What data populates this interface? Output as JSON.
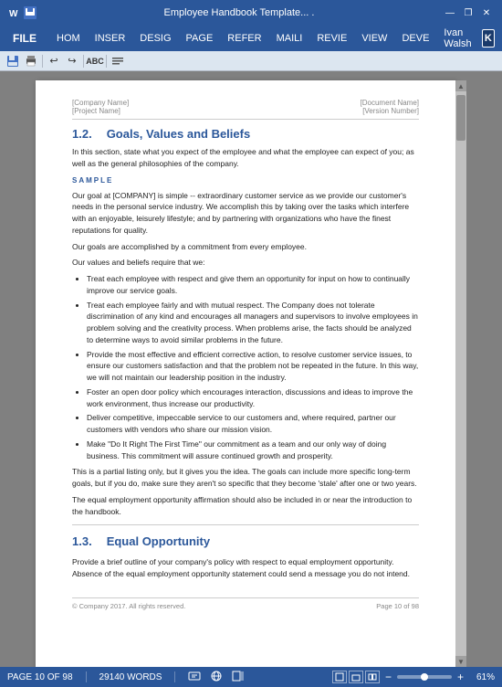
{
  "titlebar": {
    "title": "Employee Handbook Template... .",
    "question_icon": "?",
    "minimize_icon": "—",
    "restore_icon": "❐",
    "close_icon": "✕"
  },
  "ribbon": {
    "file_label": "FILE",
    "tabs": [
      "HOM",
      "INSER",
      "DESIG",
      "PAGE",
      "REFER",
      "MAILI",
      "REVIE",
      "VIEW",
      "DEVE"
    ],
    "user_name": "Ivan Walsh",
    "user_initial": "K"
  },
  "toolbar": {
    "buttons": [
      "💾",
      "🖨",
      "↩",
      "↪",
      "ABC",
      "≡"
    ]
  },
  "document": {
    "header_left": [
      "[Company Name]",
      "[Project Name]"
    ],
    "header_right": [
      "[Document Name]",
      "[Version Number]"
    ],
    "section_num": "1.2.",
    "section_title": "Goals, Values and Beliefs",
    "intro": "In this section, state what you expect of the employee and what the employee can expect of you; as well as the general philosophies of the company.",
    "sample_label": "SAMPLE",
    "para1": "Our goal at [COMPANY] is simple -- extraordinary customer service as we provide our customer's needs in the personal service industry. We accomplish this by taking over the tasks which interfere with an enjoyable, leisurely lifestyle; and by partnering with organizations who have the finest reputations for quality.",
    "para2": "Our goals are accomplished by a commitment from every employee.",
    "para3": "Our values and beliefs require that we:",
    "bullets": [
      "Treat each employee with respect and give them an opportunity for input on how to continually improve our service goals.",
      "Treat each employee fairly and with mutual respect. The Company does not tolerate discrimination of any kind and encourages all managers and supervisors to involve employees in problem solving and the creativity process. When problems arise, the facts should be analyzed to determine ways to avoid similar problems in the future.",
      "Provide the most effective and efficient corrective action, to resolve customer service issues, to ensure our customers satisfaction and that the problem not be repeated in the future. In this way, we will not maintain our leadership position in the industry.",
      "Foster an open door policy which encourages interaction, discussions and ideas to improve the work environment, thus increase our productivity.",
      "Deliver competitive, impeccable service to our customers and, where required, partner our customers with vendors who share our mission vision.",
      "Make \"Do It Right The First Time\" our commitment as a team and our only way of doing business. This commitment will assure continued growth and prosperity."
    ],
    "para4": "This is a partial listing only, but it gives you the idea. The goals can include more specific long-term goals, but if you do, make sure they aren't so specific that they become 'stale' after one or two years.",
    "para5": "The equal employment opportunity affirmation should also be included in or near the introduction to the handbook.",
    "section2_num": "1.3.",
    "section2_title": "Equal Opportunity",
    "para6": "Provide a brief outline of your company's policy with respect to equal employment opportunity. Absence of the equal employment opportunity statement could send a message you do not intend.",
    "footer_left": "© Company 2017. All rights reserved.",
    "footer_right": "Page 10 of 98"
  },
  "statusbar": {
    "page_label": "PAGE 10 OF 98",
    "words_label": "29140 WORDS",
    "zoom_percent": "61%",
    "icons": [
      "track",
      "language",
      "layout"
    ]
  }
}
